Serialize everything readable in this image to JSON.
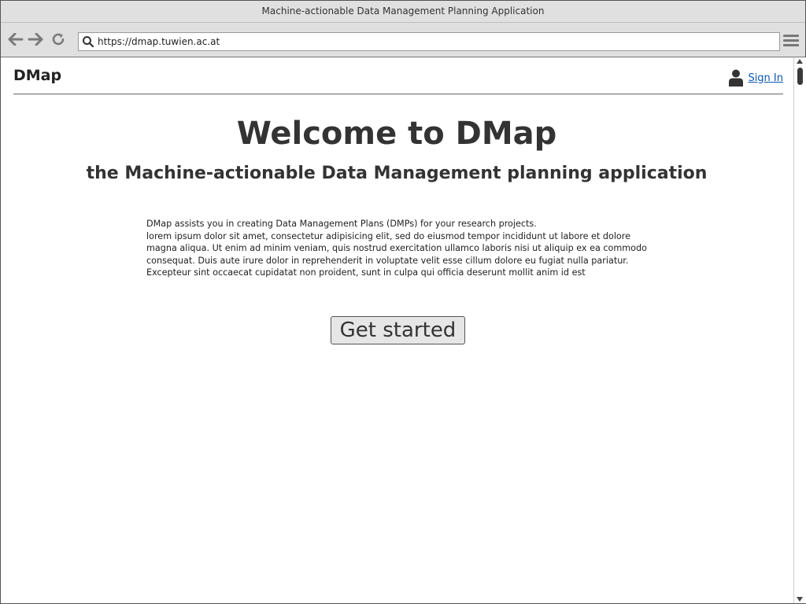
{
  "window": {
    "title": "Machine-actionable Data Management Planning Application"
  },
  "browser": {
    "url": "https://dmap.tuwien.ac.at",
    "icons": {
      "back": "arrow-left-icon",
      "forward": "arrow-right-icon",
      "reload": "reload-icon",
      "search": "search-icon",
      "menu": "hamburger-menu-icon"
    }
  },
  "header": {
    "brand": "DMap",
    "sign_in_label": "Sign In",
    "user_icon": "user-icon"
  },
  "main": {
    "title": "Welcome to DMap",
    "subtitle": "the Machine-actionable Data Management planning application",
    "intro_line1": "DMap assists you in creating Data Management Plans (DMPs) for your research projects.",
    "intro_line2": "lorem ipsum dolor sit amet, consectetur adipisicing elit, sed do eiusmod tempor incididunt ut labore et dolore magna aliqua. Ut enim ad minim veniam, quis nostrud exercitation ullamco laboris nisi ut aliquip ex ea commodo consequat. Duis aute irure dolor in reprehenderit in voluptate velit esse cillum dolore eu fugiat nulla pariatur. Excepteur sint occaecat cupidatat non proident, sunt in culpa qui officia deserunt mollit anim id est",
    "cta_label": "Get started"
  },
  "colors": {
    "link": "#0b57b3",
    "chrome": "#e0e0e0",
    "text": "#333333"
  }
}
